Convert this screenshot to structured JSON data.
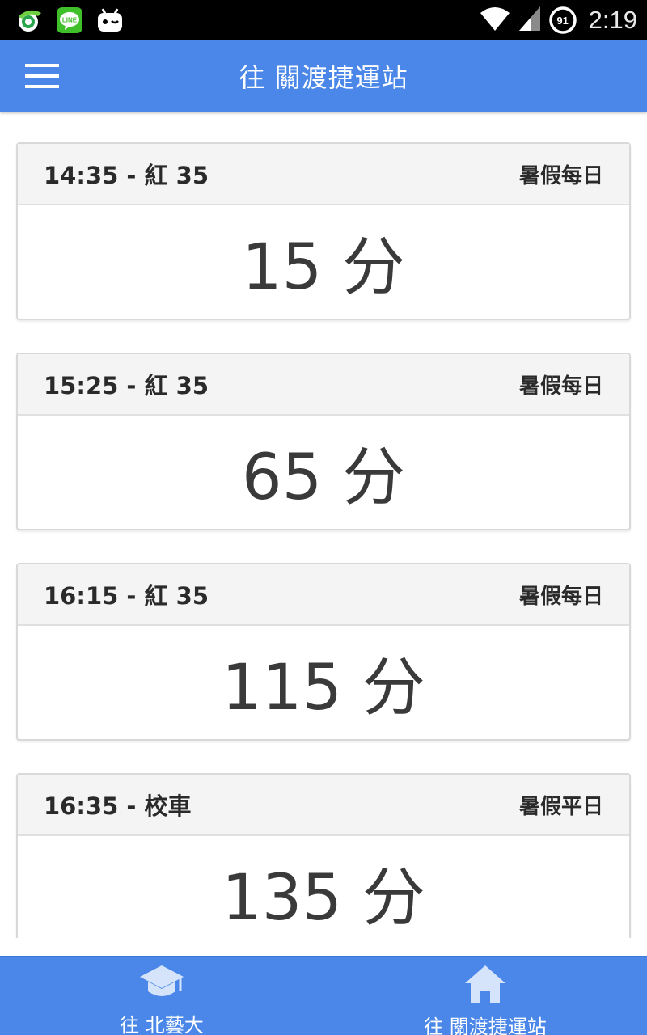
{
  "status_bar": {
    "time": "2:19",
    "battery_level": "91",
    "notification_icons": [
      "qq-browser-icon",
      "line-icon",
      "android-robot-icon"
    ],
    "line_text": "LINE"
  },
  "app_bar": {
    "title": "往 關渡捷運站"
  },
  "departures": [
    {
      "route": "14:35 - 紅 35",
      "schedule": "暑假每日",
      "minutes": "15 分"
    },
    {
      "route": "15:25 - 紅 35",
      "schedule": "暑假每日",
      "minutes": "65 分"
    },
    {
      "route": "16:15 - 紅 35",
      "schedule": "暑假每日",
      "minutes": "115 分"
    },
    {
      "route": "16:35 - 校車",
      "schedule": "暑假平日",
      "minutes": "135 分"
    }
  ],
  "bottom_nav": {
    "items": [
      {
        "label": "往 北藝大",
        "icon": "graduation-cap-icon"
      },
      {
        "label": "往 關渡捷運站",
        "icon": "home-icon"
      }
    ]
  },
  "colors": {
    "primary": "#4a87e8",
    "status_bar": "#000000",
    "card_header": "#f4f4f4"
  }
}
